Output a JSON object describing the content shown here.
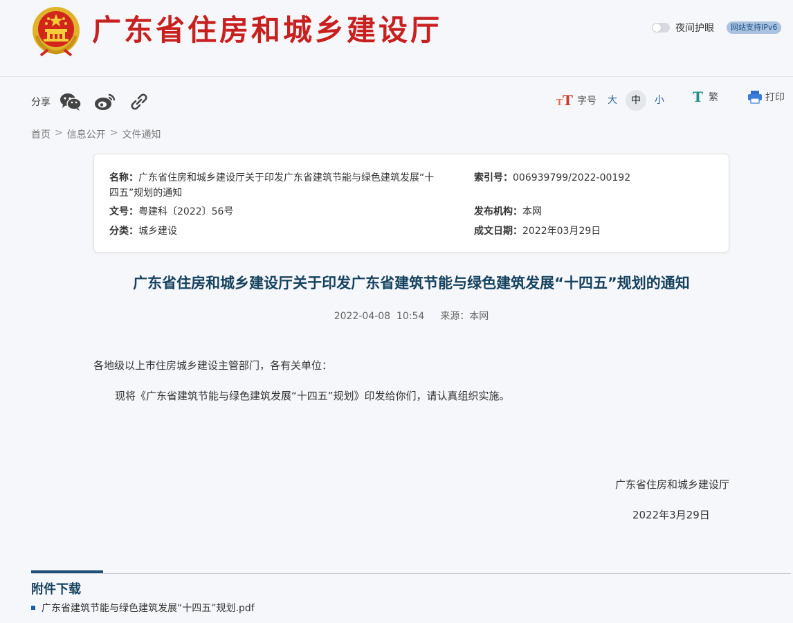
{
  "header": {
    "site_title": "广东省住房和城乡建设厅",
    "night_mode_label": "夜间护眼",
    "ipv6_badge": "网站支持IPv6"
  },
  "toolbar": {
    "share_label": "分享",
    "font_size_label": "字号",
    "font_sizes": [
      "大",
      "中",
      "小"
    ],
    "font_size_selected": "中",
    "traditional_label": "繁",
    "print_label": "打印"
  },
  "breadcrumb": [
    "首页",
    "信息公开",
    "文件通知"
  ],
  "meta": {
    "name_key": "名称：",
    "name_val_line1": "广东省住房和城乡建设厅关于印发广东省建筑节能与绿色建筑发展“十",
    "name_val_line2": "四五”规划的通知",
    "index_key": "索引号：",
    "index_val": "006939799/2022-00192",
    "docno_key": "文号：",
    "docno_val": "粤建科〔2022〕56号",
    "publisher_key": "发布机构：",
    "publisher_val": "本网",
    "category_key": "分类：",
    "category_val": "城乡建设",
    "date_key": "成文日期：",
    "date_val": "2022年03月29日"
  },
  "article": {
    "title": "广东省住房和城乡建设厅关于印发广东省建筑节能与绿色建筑发展“十四五”规划的通知",
    "datetime": "2022-04-08  10:54",
    "source": "来源：本网",
    "salutation": "各地级以上市住房城乡建设主管部门，各有关单位：",
    "body": "现将《广东省建筑节能与绿色建筑发展“十四五”规划》印发给你们，请认真组织实施。",
    "signature": "广东省住房和城乡建设厅",
    "sign_date": "2022年3月29日"
  },
  "attachments": {
    "title": "附件下载",
    "items": [
      "广东省建筑节能与绿色建筑发展“十四五”规划.pdf"
    ]
  },
  "colors": {
    "brand_red": "#c81f1f",
    "title_blue": "#15425f",
    "link_blue": "#1f5f9e"
  }
}
